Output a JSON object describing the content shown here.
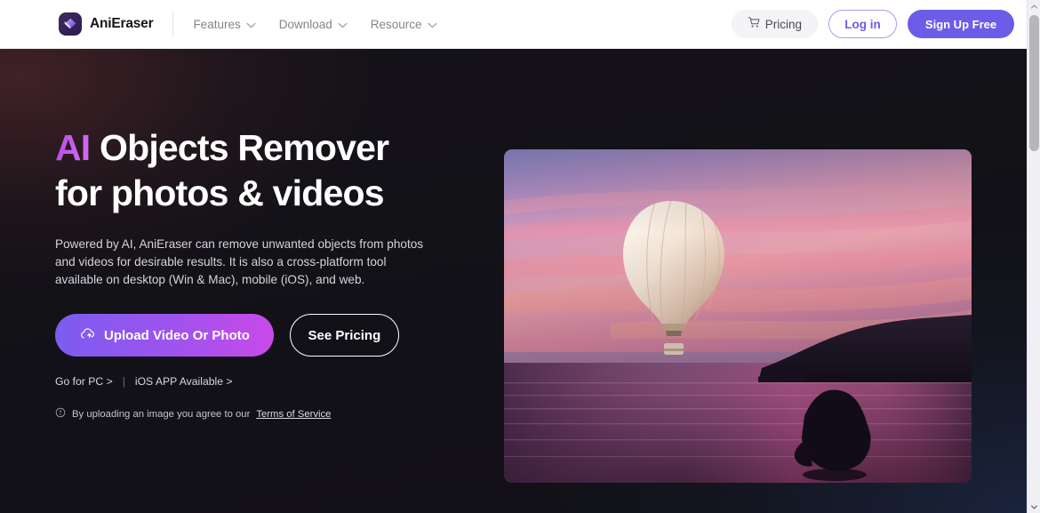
{
  "header": {
    "brand": {
      "name": "AniEraser",
      "logo_icon": "eraser-logo-icon"
    },
    "nav": [
      {
        "label": "Features",
        "icon": "chevron-down-icon"
      },
      {
        "label": "Download",
        "icon": "chevron-down-icon"
      },
      {
        "label": "Resource",
        "icon": "chevron-down-icon"
      }
    ],
    "actions": {
      "pricing_label": "Pricing",
      "pricing_icon": "shopping-cart-icon",
      "login_label": "Log in",
      "signup_label": "Sign Up Free"
    }
  },
  "hero": {
    "headline_accent": "AI",
    "headline_rest": " Objects Remover",
    "headline_line2": "for photos & videos",
    "subcopy": "Powered by AI, AniEraser can remove unwanted objects from photos and videos for desirable results. It is also a cross-platform tool available on desktop (Win & Mac), mobile (iOS), and web.",
    "cta": {
      "upload_label": "Upload Video Or Photo",
      "upload_icon": "cloud-upload-icon",
      "pricing_label": "See Pricing"
    },
    "links": {
      "pc_label": "Go for PC >",
      "separator": "|",
      "ios_label": "iOS APP Available >"
    },
    "terms": {
      "icon": "info-circle-icon",
      "text": "By uploading an image you agree to our",
      "link_label": "Terms of Service"
    },
    "figure": {
      "name": "hot-air-balloon-sunset-photo",
      "alt": "Hot air balloon over a sea at sunset with a dark cliff and a rock"
    }
  },
  "colors": {
    "brand_purple": "#6c5ce7",
    "accent_magenta": "#c94ae8",
    "hero_background": "#121117",
    "header_background": "#ffffff",
    "nav_text": "#84848d",
    "pricing_pill": "#f4f4f7"
  },
  "scrollbar": {
    "up_icon": "scroll-up-arrow-icon",
    "down_icon": "scroll-down-arrow-icon"
  }
}
